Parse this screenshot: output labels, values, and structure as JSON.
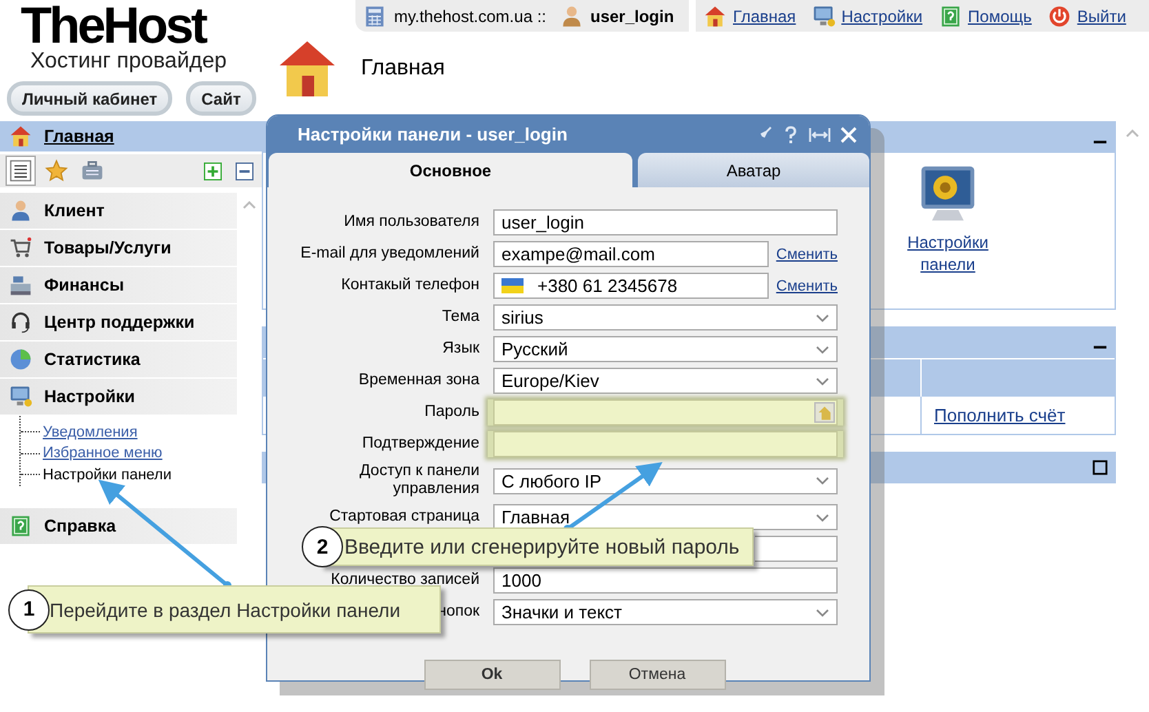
{
  "brand": {
    "name": "TheHost",
    "tagline": "Хостинг провайдер"
  },
  "header_buttons": [
    "Личный кабинет",
    "Сайт"
  ],
  "top_bar": {
    "host": "my.thehost.com.ua ::",
    "user": "user_login"
  },
  "top_links": [
    {
      "label": "Главная",
      "kind": "home"
    },
    {
      "label": "Настройки",
      "kind": "monitor"
    },
    {
      "label": "Помощь",
      "kind": "help"
    },
    {
      "label": "Выйти",
      "kind": "power"
    }
  ],
  "page_title": "Главная",
  "sidebar": {
    "home": {
      "label": "Главная",
      "selected": true
    },
    "toolbar": [
      {
        "kind": "list",
        "selected": true
      },
      {
        "kind": "star",
        "selected": false
      },
      {
        "kind": "briefcase",
        "selected": false
      }
    ],
    "items": [
      {
        "label": "Клиент",
        "kind": "client"
      },
      {
        "label": "Товары/Услуги",
        "kind": "cart"
      },
      {
        "label": "Финансы",
        "kind": "cash"
      },
      {
        "label": "Центр поддержки",
        "kind": "headset"
      },
      {
        "label": "Статистика",
        "kind": "pie"
      },
      {
        "label": "Настройки",
        "kind": "monitor",
        "children": [
          {
            "label": "Уведомления",
            "selected": false
          },
          {
            "label": "Избранное меню",
            "selected": false
          },
          {
            "label": "Настройки панели",
            "selected": true
          }
        ]
      },
      {
        "label": "Справка",
        "kind": "help"
      }
    ]
  },
  "panels": [
    {
      "collapsed": false,
      "kind": "shortcut",
      "link": "Настройки панели"
    },
    {
      "collapsed": false,
      "kind": "table",
      "link": "Пополнить счёт"
    },
    {
      "collapsed": true
    }
  ],
  "dialog": {
    "title": "Настройки панели - user_login",
    "tabs": [
      {
        "label": "Основное",
        "selected": true
      },
      {
        "label": "Аватар",
        "selected": false
      }
    ],
    "fields": [
      {
        "kind": "text",
        "label": "Имя пользователя",
        "value": "user_login"
      },
      {
        "kind": "text",
        "label": "E-mail для уведомлений",
        "value": "exampe@mail.com",
        "action": "Сменить"
      },
      {
        "kind": "phone",
        "label": "Контакый телефон",
        "value": "+380 61 2345678",
        "action": "Сменить"
      },
      {
        "kind": "select",
        "label": "Тема",
        "value": "sirius"
      },
      {
        "kind": "select",
        "label": "Язык",
        "value": "Русский"
      },
      {
        "kind": "select",
        "label": "Временная зона",
        "value": "Europe/Kiev"
      },
      {
        "kind": "password",
        "label": "Пароль",
        "generator": true
      },
      {
        "kind": "password",
        "label": "Подтверждение",
        "generator": false
      },
      {
        "kind": "select",
        "label": "Доступ к панели управления",
        "value": "С любого IP"
      },
      {
        "kind": "select",
        "label": "Стартовая страница",
        "value": "Главная"
      },
      {
        "kind": "text"
      },
      {
        "kind": "text",
        "label": "Количество записей",
        "value": "1000"
      },
      {
        "kind": "select",
        "label": "нопок",
        "value": "Значки и текст"
      }
    ],
    "buttons": [
      {
        "label": "Ok",
        "default": true
      },
      {
        "label": "Отмена",
        "default": false
      }
    ]
  },
  "callouts": [
    {
      "number": "1",
      "text": "Перейдите в раздел Настройки панели"
    },
    {
      "number": "2",
      "text": "Введите или сгенерируйте новый пароль"
    }
  ]
}
